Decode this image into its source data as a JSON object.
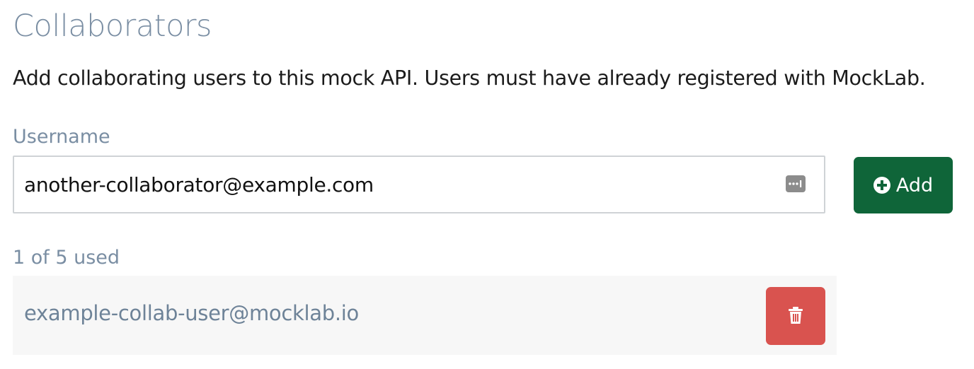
{
  "section": {
    "title": "Collaborators",
    "description": "Add collaborating users to this mock API. Users must have already registered with MockLab."
  },
  "form": {
    "username_label": "Username",
    "username_value": "another-collaborator@example.com",
    "password_manager_icon": "password-manager-icon",
    "add_button_label": "Add",
    "add_button_icon": "plus-circle-icon",
    "accent_color": "#0f6539"
  },
  "collaborators": {
    "usage_text": "1 of 5 used",
    "used": 1,
    "limit": 5,
    "items": [
      {
        "email": "example-collab-user@mocklab.io",
        "delete_icon": "trash-icon"
      }
    ],
    "delete_color": "#d9534f"
  }
}
